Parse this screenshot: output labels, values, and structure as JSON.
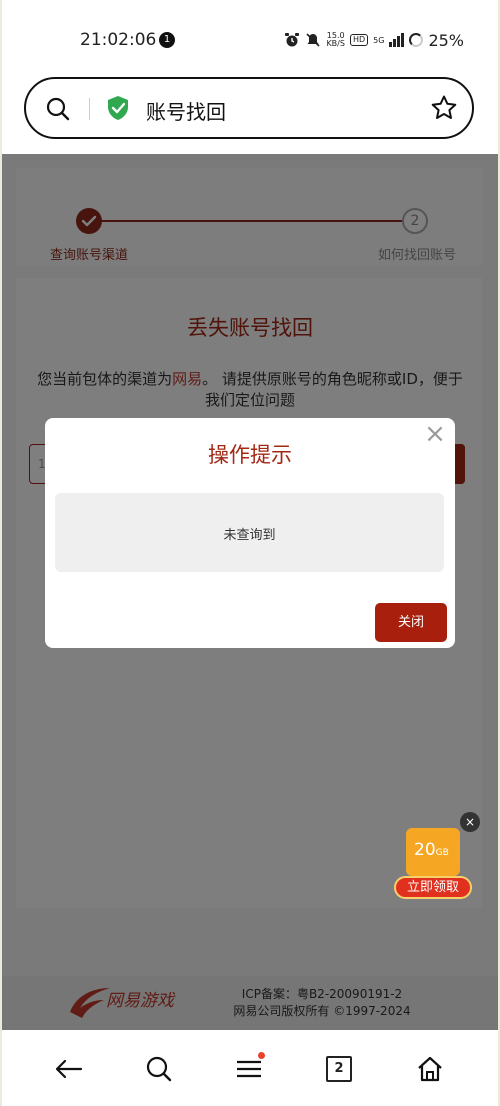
{
  "status_bar": {
    "time": "21:02:06",
    "notification_count": "1",
    "net_speed_top": "15.0",
    "net_speed_bottom": "KB/S",
    "hd_label": "HD",
    "network": "5G",
    "battery": "25%"
  },
  "address_bar": {
    "title": "账号找回"
  },
  "steps": {
    "step1_label": "查询账号渠道",
    "step2_number": "2",
    "step2_label": "如何找回账号"
  },
  "main": {
    "title": "丢失账号找回",
    "desc_prefix": "您当前包体的渠道为",
    "desc_channel": "网易",
    "desc_suffix": "。 请提供原账号的角色昵称或ID，便于我们定位问题",
    "input_placeholder_visible": "1("
  },
  "footer": {
    "logo_text": "网易游戏",
    "icp": "ICP备案：粤B2-20090191-2",
    "copyright": "网易公司版权所有 ©1997-2024"
  },
  "modal": {
    "title": "操作提示",
    "close_glyph": "×",
    "message": "未查询到",
    "button_label": "关闭"
  },
  "promo": {
    "size_number": "20",
    "size_unit": "GB",
    "button_label": "立即领取",
    "close_glyph": "×"
  },
  "bottom_nav": {
    "tab_count": "2"
  },
  "colors": {
    "accent": "#a32715",
    "overlay": "rgba(0,0,0,0.5)",
    "shield": "#2fa84f"
  }
}
